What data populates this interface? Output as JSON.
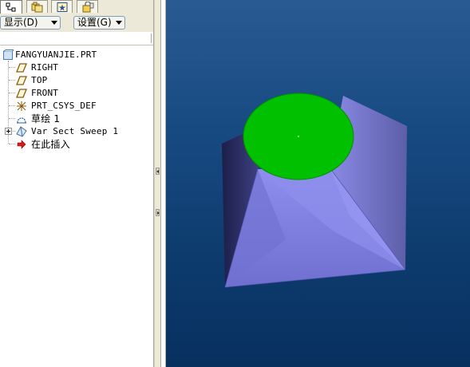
{
  "toolbar": {
    "tabs": [
      {
        "icon": "model-tree-icon"
      },
      {
        "icon": "folder-browser-icon"
      },
      {
        "icon": "favorites-icon"
      },
      {
        "icon": "connections-icon"
      }
    ],
    "show_label": "显示(D)",
    "settings_label": "设置(G)"
  },
  "tree": {
    "root": {
      "label": "FANGYUANJIE.PRT",
      "icon": "part-icon"
    },
    "items": [
      {
        "label": "RIGHT",
        "icon": "datum-plane-icon"
      },
      {
        "label": "TOP",
        "icon": "datum-plane-icon"
      },
      {
        "label": "FRONT",
        "icon": "datum-plane-icon"
      },
      {
        "label": "PRT_CSYS_DEF",
        "icon": "coordinate-system-icon"
      },
      {
        "label": "草绘 1",
        "icon": "sketch-icon"
      },
      {
        "label": "Var Sect Sweep 1",
        "icon": "sweep-feature-icon"
      },
      {
        "label": "在此插入",
        "icon": "insert-here-arrow-icon"
      }
    ]
  },
  "viewport": {
    "background_top": "#2a5a92",
    "background_bottom": "#07305e",
    "model_color": "#8080e0",
    "top_face_color": "#00c000"
  }
}
